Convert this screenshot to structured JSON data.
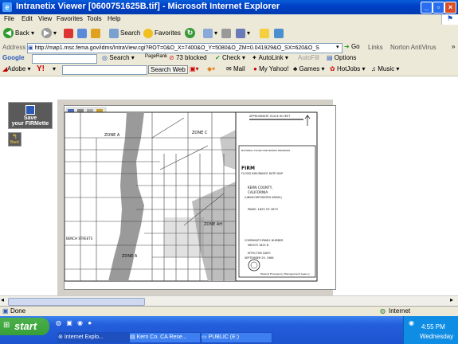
{
  "window": {
    "title": "Intranetix Viewer [0600751625B.tif] - Microsoft Internet Explorer"
  },
  "menu": {
    "items": [
      "File",
      "Edit",
      "View",
      "Favorites",
      "Tools",
      "Help"
    ]
  },
  "toolbar": {
    "back": "Back",
    "search": "Search",
    "favorites": "Favorites"
  },
  "address": {
    "label": "Address",
    "url": "http://map1.msc.fema.gov/idms/IntraView.cgi?ROT=0&O_X=7400&O_Y=5080&O_ZM=0.041929&O_SX=620&O_S",
    "go": "Go",
    "links": "Links",
    "norton": "Norton AntiVirus"
  },
  "googlebar": {
    "brand": "Google",
    "search": "Search",
    "pagerank": "PageRank",
    "blocked": "73 blocked",
    "check": "Check",
    "autolink": "AutoLink",
    "autofill": "AutoFill",
    "options": "Options"
  },
  "yahoobar": {
    "adobe": "Adobe",
    "yahoo": "Y!",
    "search_web": "Search Web",
    "mail": "Mail",
    "myyahoo": "My Yahoo!",
    "games": "Games",
    "hotjobs": "HotJobs",
    "music": "Music"
  },
  "sidebar": {
    "save_line1": "Save",
    "save_line2": "your FIRMette",
    "back": "Back"
  },
  "map": {
    "scale": "APPROXIMATE SCALE IN FEET",
    "program": "NATIONAL FLOOD INSURANCE PROGRAM",
    "firm": "FIRM",
    "firm_full": "FLOOD INSURANCE RATE MAP",
    "county": "KERN COUNTY,",
    "state": "CALIFORNIA",
    "area": "(UNINCORPORATED AREAS)",
    "panel": "PANEL 1625 OF 2875",
    "community_label": "COMMUNITY-PANEL NUMBER",
    "community_number": "060075 1625 B",
    "effective_label": "EFFECTIVE DATE:",
    "effective_date": "SEPTEMBER 29, 1986",
    "agency": "Federal Emergency Management Agency",
    "zone_a": "ZONE A",
    "zone_c": "ZONE C",
    "zone_ah": "ZONE AH",
    "zone_a2": "ZONE A",
    "streets_label": "BENCH STREETS"
  },
  "status": {
    "text": "Done",
    "zone": "Internet"
  },
  "taskbar": {
    "start": "start",
    "tasks": [
      "Internet Explo...",
      "Kern Co. CA Rese...",
      "PUBLIC (E:)"
    ],
    "time": "4:55 PM",
    "day": "Wednesday"
  }
}
